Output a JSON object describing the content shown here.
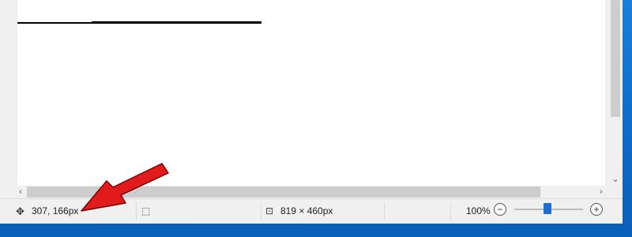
{
  "status": {
    "cursor_position": "307, 166px",
    "image_size": "819 × 460px",
    "zoom_level": "100%"
  },
  "scrollbars": {
    "down_arrow": "⌄",
    "left_arrow": "‹",
    "right_arrow": "›"
  },
  "zoom": {
    "minus": "−",
    "plus": "+",
    "slider_fraction": 0.5
  },
  "icons": {
    "cursor_icon": "move-cursor-icon",
    "selection_icon": "selection-size-icon",
    "image_size_icon": "image-size-icon",
    "zoom_out_icon": "minus-circle-icon",
    "zoom_in_icon": "plus-circle-icon"
  },
  "colors": {
    "desktop_blue": "#0f6fce",
    "annotation_red": "#e11b1b",
    "slider_blue": "#1a6fd0"
  }
}
